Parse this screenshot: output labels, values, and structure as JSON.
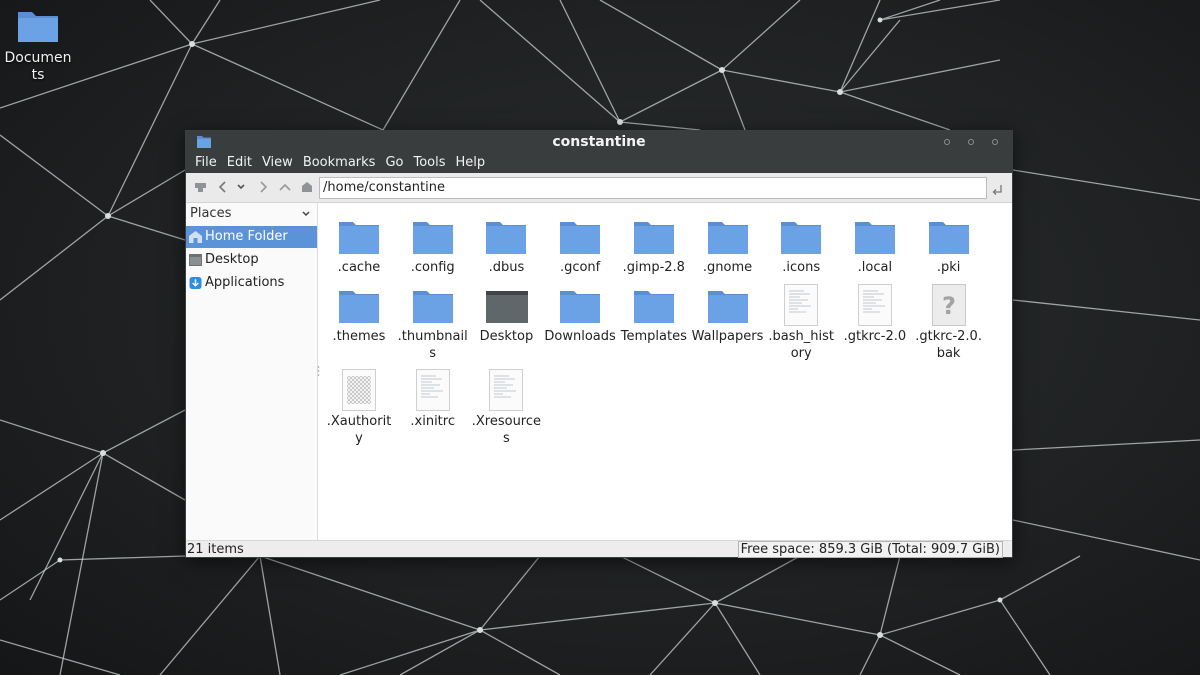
{
  "desktop": {
    "icons": [
      {
        "label": "Documents",
        "icon": "folder-icon"
      }
    ]
  },
  "window": {
    "title": "constantine",
    "menu": [
      "File",
      "Edit",
      "View",
      "Bookmarks",
      "Go",
      "Tools",
      "Help"
    ],
    "toolbar": {
      "location": "/home/constantine",
      "buttons": [
        "drive-icon",
        "back-icon",
        "dropdown-icon",
        "forward-icon",
        "up-icon",
        "home-icon"
      ]
    },
    "sidebar": {
      "header": "Places",
      "items": [
        {
          "label": "Home Folder",
          "icon": "home-icon",
          "active": true
        },
        {
          "label": "Desktop",
          "icon": "desktop-icon",
          "active": false
        },
        {
          "label": "Applications",
          "icon": "applications-icon",
          "active": false
        }
      ]
    },
    "files": [
      {
        "name": ".cache",
        "type": "folder"
      },
      {
        "name": ".config",
        "type": "folder"
      },
      {
        "name": ".dbus",
        "type": "folder"
      },
      {
        "name": ".gconf",
        "type": "folder"
      },
      {
        "name": ".gimp-2.8",
        "type": "folder"
      },
      {
        "name": ".gnome",
        "type": "folder"
      },
      {
        "name": ".icons",
        "type": "folder"
      },
      {
        "name": ".local",
        "type": "folder"
      },
      {
        "name": ".pki",
        "type": "folder"
      },
      {
        "name": ".themes",
        "type": "folder"
      },
      {
        "name": ".thumbnails",
        "type": "folder"
      },
      {
        "name": "Desktop",
        "type": "desktop-folder"
      },
      {
        "name": "Downloads",
        "type": "folder"
      },
      {
        "name": "Templates",
        "type": "folder"
      },
      {
        "name": "Wallpapers",
        "type": "folder"
      },
      {
        "name": ".bash_history",
        "type": "text"
      },
      {
        "name": ".gtkrc-2.0",
        "type": "text"
      },
      {
        "name": ".gtkrc-2.0.bak",
        "type": "unknown"
      },
      {
        "name": ".Xauthority",
        "type": "binary"
      },
      {
        "name": ".xinitrc",
        "type": "text"
      },
      {
        "name": ".Xresources",
        "type": "text"
      }
    ],
    "status": {
      "count": "21 items",
      "free_space": "Free space: 859.3 GiB (Total: 909.7 GiB)"
    }
  },
  "colors": {
    "folder": "#6ba2e6",
    "folder_tab": "#5a8fd3",
    "selection": "#5b93d8",
    "titlebar": "#3a3d3e"
  }
}
